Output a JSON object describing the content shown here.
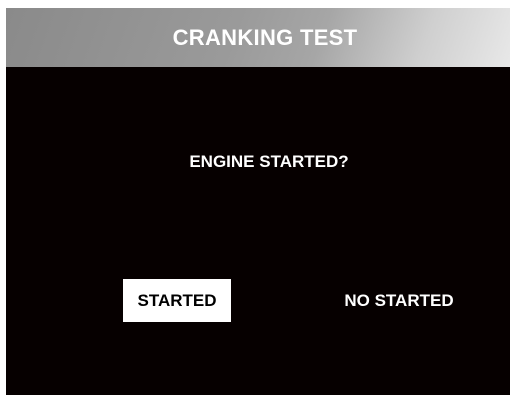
{
  "header": {
    "title": "CRANKING TEST"
  },
  "prompt": {
    "question": "ENGINE STARTED?"
  },
  "options": {
    "started_label": "STARTED",
    "no_started_label": "NO STARTED",
    "selected": "STARTED"
  },
  "colors": {
    "background": "#060000",
    "text": "#ffffff",
    "selected_background": "#ffffff",
    "selected_text": "#000000",
    "header_gradient_start": "#8a8a8a",
    "header_gradient_end": "#e8e8e8"
  }
}
